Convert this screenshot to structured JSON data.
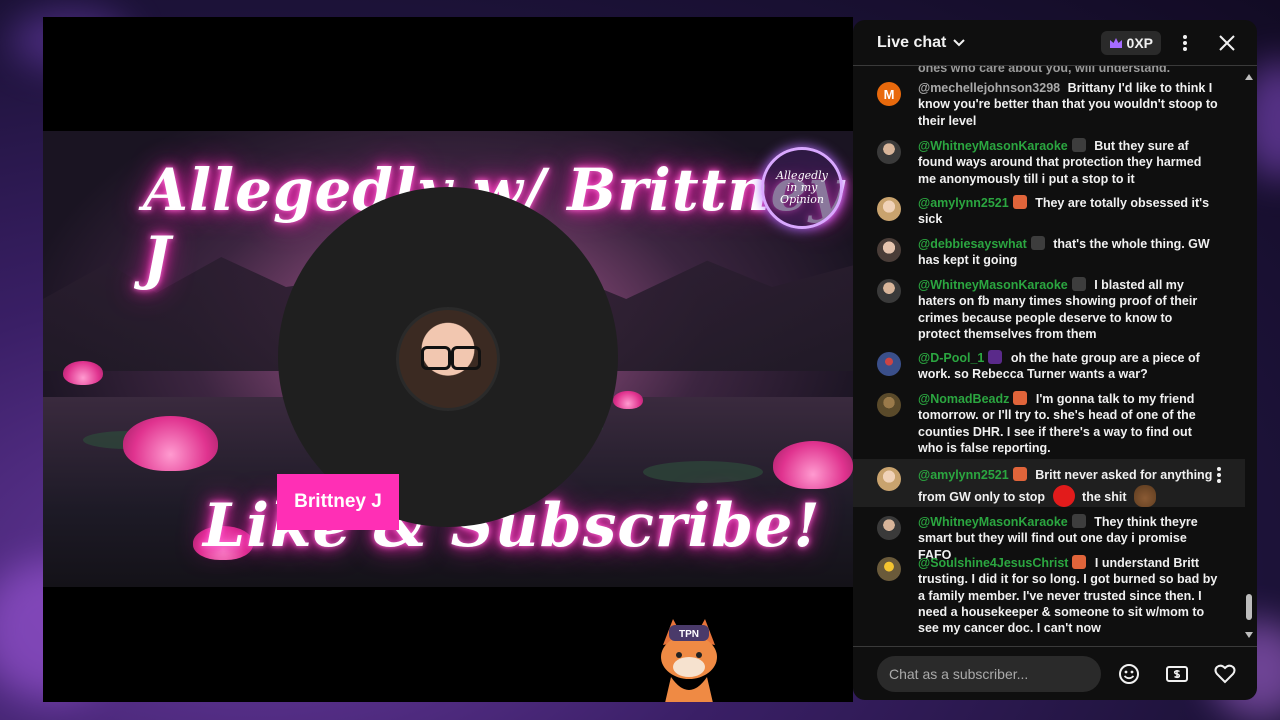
{
  "video": {
    "title_art": "Allegedly w/ Brittney J",
    "subtitle_art": "Like & Subscribe!",
    "logo_text": "Allegedly in my Opinion",
    "speaker_name": "Brittney J",
    "fox_badge_text": "TPN"
  },
  "chat": {
    "title": "Live chat",
    "xp_label": "0XP",
    "input_placeholder": "Chat as a subscriber...",
    "truncated_top_text": "ones who care about you, will understand.",
    "messages": [
      {
        "author": "@mechellejohnson3298",
        "text": "Brittany I'd like to think I know you're better than that you wouldn't stoop to their level",
        "avatar_letter": "M"
      },
      {
        "author": "@WhitneyMasonKaraoke",
        "text": "But they sure af found ways around that protection they harmed me anonymously till i put a stop to it"
      },
      {
        "author": "@amylynn2521",
        "text": "They are totally obsessed it's sick"
      },
      {
        "author": "@debbiesayswhat",
        "text": "that's the whole thing. GW has kept it going"
      },
      {
        "author": "@WhitneyMasonKaraoke",
        "text": "I blasted all my haters on fb many times showing proof of their crimes because people deserve to know to protect themselves from them"
      },
      {
        "author": "@D-Pool_1",
        "text": "oh the hate group are a piece of work. so Rebecca Turner wants a war?"
      },
      {
        "author": "@NomadBeadz",
        "text": "I'm gonna talk to my friend tomorrow. or I'll try to. she's head of one of the counties DHR. I see if there's a way to find out who is false reporting."
      },
      {
        "author": "@amylynn2521",
        "text_a": "Britt never asked for anything from GW only to stop",
        "text_b": "the shit"
      },
      {
        "author": "@WhitneyMasonKaraoke",
        "text": "They think theyre smart but they will find out one day i promise FAFO"
      },
      {
        "author": "@Soulshine4JesusChrist",
        "text": "I understand Britt trusting. I did it for so long. I got burned so bad by a family member. I've never trusted since then. I need a housekeeper & someone to sit w/mom to see my cancer doc. I can't now"
      }
    ]
  },
  "colors": {
    "author_green": "#2ba640",
    "name_tag_pink": "#ff2fb5",
    "avatar_orange": "#e8690c"
  }
}
